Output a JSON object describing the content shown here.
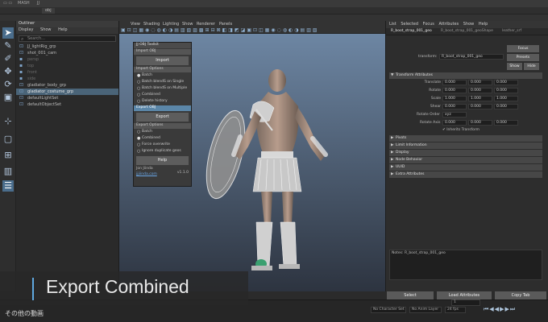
{
  "top": {
    "menu1": "MASH",
    "menu2": "JJ",
    "tab": "obj",
    "tab2": "OB"
  },
  "outliner": {
    "title": "Outliner",
    "menu": [
      "Display",
      "Show",
      "Help"
    ],
    "search_placeholder": "Search...",
    "items": [
      {
        "label": "JJ_lightRig_grp",
        "dim": false,
        "sel": false
      },
      {
        "label": "shot_001_cam",
        "dim": false,
        "sel": false
      },
      {
        "label": "persp",
        "dim": true,
        "sel": false
      },
      {
        "label": "top",
        "dim": true,
        "sel": false
      },
      {
        "label": "front",
        "dim": true,
        "sel": false
      },
      {
        "label": "side",
        "dim": true,
        "sel": false
      },
      {
        "label": "gladiator_body_grp",
        "dim": false,
        "sel": false
      },
      {
        "label": "gladiator_costume_grp",
        "dim": false,
        "sel": true
      },
      {
        "label": "defaultLightSet",
        "dim": false,
        "sel": false
      },
      {
        "label": "defaultObjectSet",
        "dim": false,
        "sel": false
      }
    ]
  },
  "viewport": {
    "menu": [
      "View",
      "Shading",
      "Lighting",
      "Show",
      "Renderer",
      "Panels"
    ],
    "camera_label": "persp"
  },
  "toolkit": {
    "title": "JJ OBJ Toolkit",
    "import_section": "Import OBJ",
    "import_btn": "Import",
    "import_options": "Import Options",
    "import_opts": [
      "Batch",
      "Batch blendS on Single",
      "Batch blendS on Multiple",
      "Combined",
      "Delete history"
    ],
    "import_checked": [
      true,
      false,
      false,
      false,
      false
    ],
    "export_section": "Export OBJ",
    "export_btn": "Export",
    "export_options": "Export Options",
    "export_opts": [
      "Batch",
      "Combined",
      "Force overwrite",
      "Ignore duplicate geos"
    ],
    "export_checked": [
      false,
      true,
      false,
      false
    ],
    "help_btn": "Help",
    "author": "Jon Jiinda",
    "link": "jjjiinda.com",
    "version": "v1.1.0"
  },
  "attr": {
    "menu": [
      "List",
      "Selected",
      "Focus",
      "Attributes",
      "Show",
      "Help"
    ],
    "tabs": [
      "R_boot_strap_001_geo",
      "R_boot_strap_001_geoShape",
      "leather_srf"
    ],
    "transform_label": "transform:",
    "transform_value": "R_boot_strap_001_geo",
    "focus": "Focus",
    "presets": "Presets",
    "show": "Show",
    "hide": "Hide",
    "section_transform": "Transform Attributes",
    "fields": [
      {
        "label": "Translate",
        "v": [
          "0.000",
          "0.000",
          "0.000"
        ]
      },
      {
        "label": "Rotate",
        "v": [
          "0.000",
          "0.000",
          "0.000"
        ]
      },
      {
        "label": "Scale",
        "v": [
          "1.000",
          "1.000",
          "1.000"
        ]
      },
      {
        "label": "Shear",
        "v": [
          "0.000",
          "0.000",
          "0.000"
        ]
      }
    ],
    "rotate_order_label": "Rotate Order",
    "rotate_order": "xyz",
    "rotate_axis_label": "Rotate Axis",
    "rotate_axis": [
      "0.000",
      "0.000",
      "0.000"
    ],
    "inherits": "Inherits Transform",
    "frames": [
      "Pivots",
      "Limit Information",
      "Display",
      "Node Behavior",
      "UUID",
      "Extra Attributes"
    ],
    "notes": "Notes:  R_boot_strap_001_geo",
    "select": "Select",
    "load": "Load Attributes",
    "copy": "Copy Tab"
  },
  "caption": "Export Combined",
  "footer_jp": "その他の動画",
  "timeline": {
    "no_character_set": "No Character Set",
    "no_anim_layer": "No Anim Layer",
    "fps": "24 fps",
    "frame": "1"
  },
  "colors": {
    "accent": "#5fa8e0",
    "selection": "#4a6478"
  }
}
